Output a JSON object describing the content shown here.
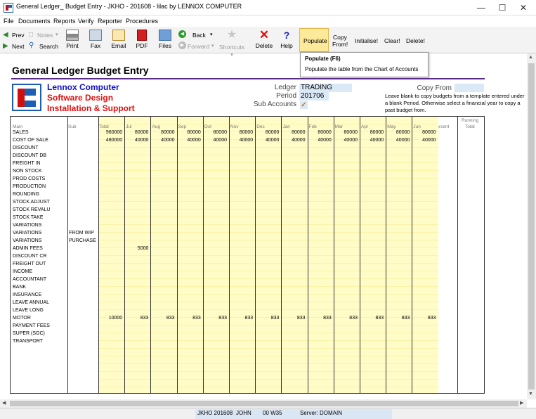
{
  "window": {
    "title": "General Ledger_ Budget Entry - JKHO - 201608 - lilac by LENNOX COMPUTER"
  },
  "menu": [
    "File",
    "Documents",
    "Reports",
    "Verify",
    "Reporter",
    "Procedures"
  ],
  "toolbar": {
    "prev": "Prev",
    "next": "Next",
    "notes": "Notes",
    "search": "Search",
    "print": "Print",
    "fax": "Fax",
    "email": "Email",
    "pdf": "PDF",
    "files": "Files",
    "back": "Back",
    "forward": "Forward",
    "shortcuts": "Shortcuts",
    "delete": "Delete",
    "help": "Help",
    "populate": "Populate",
    "copy_from_1": "Copy",
    "copy_from_2": "From!",
    "initialise": "Initialise!",
    "clear": "Clear!",
    "delete_bang": "Delete!"
  },
  "tooltip": {
    "title": "Populate (F6)",
    "body": "Populate the table from the Chart of Accounts"
  },
  "page": {
    "heading": "General Ledger Budget Entry",
    "company_line1": "Lennox Computer",
    "company_line2": "Software Design",
    "company_line3": "Installation & Support"
  },
  "form": {
    "ledger_label": "Ledger",
    "ledger_value": "TRADING",
    "period_label": "Period",
    "period_value": "201706",
    "sub_accounts_label": "Sub Accounts",
    "sub_accounts_checked": "✓",
    "copy_from_label": "Copy From",
    "hint": "Leave blank to copy budgets from a template entered under a blank Period. Otherwise select a financial year to copy a past budget from."
  },
  "table": {
    "headers": {
      "main": "Main",
      "sub": "Sub",
      "total": "Total",
      "months": [
        "Jul",
        "Aug",
        "Sep",
        "Oct",
        "Nov",
        "Dec",
        "Jan",
        "Feb",
        "Mar",
        "Apr",
        "May",
        "Jun"
      ],
      "percent": "Percent",
      "running_total_1": "Running",
      "running_total_2": "Total"
    },
    "rows": [
      {
        "main": "SALES",
        "sub": "",
        "total": "960000",
        "months": [
          "80000",
          "80000",
          "80000",
          "80000",
          "80000",
          "80000",
          "80000",
          "80000",
          "80000",
          "80000",
          "80000",
          "80000"
        ]
      },
      {
        "main": "COST OF SALE",
        "sub": "",
        "total": "480000",
        "months": [
          "40000",
          "40000",
          "40000",
          "40000",
          "40000",
          "40000",
          "40000",
          "40000",
          "40000",
          "40000",
          "40000",
          "40000"
        ]
      },
      {
        "main": "DISCOUNT",
        "sub": "",
        "total": "",
        "months": []
      },
      {
        "main": "DISCOUNT DB",
        "sub": "",
        "total": "",
        "months": []
      },
      {
        "main": "FREIGHT IN",
        "sub": "",
        "total": "",
        "months": []
      },
      {
        "main": "NON STOCK",
        "sub": "",
        "total": "",
        "months": []
      },
      {
        "main": "PROD COSTS",
        "sub": "",
        "total": "",
        "months": []
      },
      {
        "main": "PRODUCTION",
        "sub": "",
        "total": "",
        "months": []
      },
      {
        "main": "ROUNDING",
        "sub": "",
        "total": "",
        "months": []
      },
      {
        "main": "STOCK ADJUST",
        "sub": "",
        "total": "",
        "months": []
      },
      {
        "main": "STOCK REVALU",
        "sub": "",
        "total": "",
        "months": []
      },
      {
        "main": "STOCK TAKE",
        "sub": "",
        "total": "",
        "months": []
      },
      {
        "main": "VARIATIONS",
        "sub": "",
        "total": "",
        "months": []
      },
      {
        "main": "VARIATIONS",
        "sub": "FROM WIP",
        "total": "",
        "months": []
      },
      {
        "main": "VARIATIONS",
        "sub": "PURCHASE",
        "total": "",
        "months": []
      },
      {
        "main": "ADMIN FEES",
        "sub": "",
        "total": "",
        "months": [
          "5000"
        ]
      },
      {
        "main": "DISCOUNT CR",
        "sub": "",
        "total": "",
        "months": []
      },
      {
        "main": "FREIGHT OUT",
        "sub": "",
        "total": "",
        "months": []
      },
      {
        "main": "INCOME",
        "sub": "",
        "total": "",
        "months": []
      },
      {
        "main": "ACCOUNTANT",
        "sub": "",
        "total": "",
        "months": []
      },
      {
        "main": "BANK",
        "sub": "",
        "total": "",
        "months": []
      },
      {
        "main": "INSURANCE",
        "sub": "",
        "total": "",
        "months": []
      },
      {
        "main": "LEAVE ANNUAL",
        "sub": "",
        "total": "",
        "months": []
      },
      {
        "main": "LEAVE LONG",
        "sub": "",
        "total": "",
        "months": []
      },
      {
        "main": "MOTOR",
        "sub": "",
        "total": "10000",
        "months": [
          "833",
          "833",
          "833",
          "833",
          "833",
          "833",
          "833",
          "833",
          "833",
          "833",
          "833",
          "833"
        ]
      },
      {
        "main": "PAYMENT FEES",
        "sub": "",
        "total": "",
        "months": []
      },
      {
        "main": "SUPER (SGC)",
        "sub": "",
        "total": "",
        "months": []
      },
      {
        "main": "TRANSPORT",
        "sub": "",
        "total": "",
        "months": []
      }
    ]
  },
  "status": {
    "company": "JKHO 201608",
    "user": "JOHN",
    "terminal": "00 W35",
    "server": "Server: DOMAIN"
  }
}
